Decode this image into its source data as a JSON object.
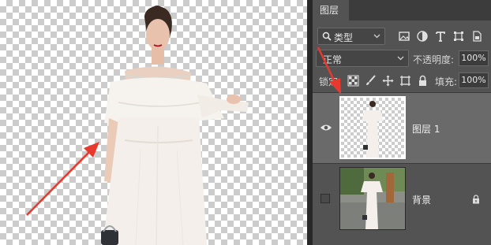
{
  "canvas": {
    "label": "transparent-canvas-with-cutout-figure"
  },
  "panel": {
    "tab_label": "图层",
    "filter": {
      "label": "类型",
      "icon": "search-icon"
    },
    "filter_icons": [
      "image-filter-icon",
      "adjustment-filter-icon",
      "type-filter-icon",
      "shape-filter-icon",
      "smart-object-filter-icon"
    ],
    "blend_mode": "正常",
    "opacity_label": "不透明度:",
    "opacity_value": "100%",
    "lock_label": "锁定:",
    "lock_icons": [
      "lock-pixels-icon",
      "lock-brush-icon",
      "lock-position-icon",
      "lock-artboard-icon",
      "lock-all-icon"
    ],
    "fill_label": "填充:",
    "fill_value": "100%"
  },
  "layers": [
    {
      "name": "图层 1",
      "visible": true,
      "selected": true,
      "locked": false
    },
    {
      "name": "背景",
      "visible": false,
      "selected": false,
      "locked": true
    }
  ],
  "colors": {
    "panel_bg": "#535353",
    "selected_layer_bg": "#6a6a6a",
    "arrow": "#e8392f",
    "dress": "#f4efea"
  }
}
